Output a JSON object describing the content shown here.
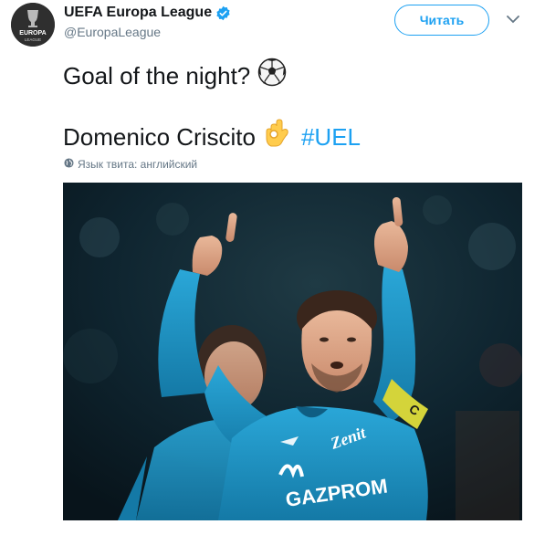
{
  "account": {
    "display_name": "UEFA Europa League",
    "handle": "@EuropaLeague",
    "avatar_text_top": "EUROPA",
    "avatar_text_bottom": "LEAGUE"
  },
  "actions": {
    "follow_label": "Читать"
  },
  "tweet": {
    "line1": "Goal of the night?",
    "line2": "Domenico Criscito",
    "hashtag": "#UEL",
    "language_note": "Язык твита: английский"
  },
  "media": {
    "jersey_sponsor": "GAZPROM",
    "jersey_club": "Zenit",
    "armband_letter": "C"
  },
  "icons": {
    "verified": "verified-badge-icon",
    "caret": "chevron-down-icon",
    "globe": "globe-icon",
    "ball": "soccer-ball-emoji",
    "ok": "ok-hand-emoji"
  },
  "colors": {
    "accent": "#1da1f2",
    "text_primary": "#14171a",
    "text_secondary": "#657786",
    "zenit_blue": "#1b95c9"
  }
}
